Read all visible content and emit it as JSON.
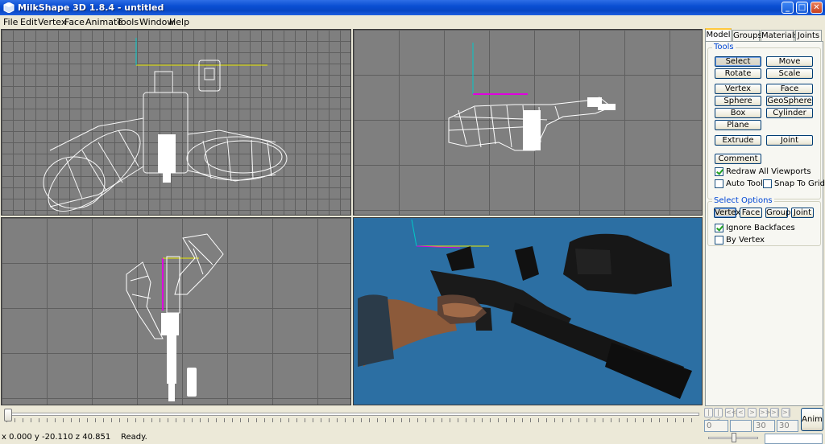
{
  "window": {
    "title": "MilkShape 3D 1.8.4 - untitled",
    "minimize": "_",
    "maximize": "□",
    "close": "✕"
  },
  "menu": [
    "File",
    "Edit",
    "Vertex",
    "Face",
    "Animate",
    "Tools",
    "Window",
    "Help"
  ],
  "tabs": [
    "Model",
    "Groups",
    "Materials",
    "Joints"
  ],
  "tools": {
    "title": "Tools",
    "buttons": [
      "Select",
      "Move",
      "Rotate",
      "Scale",
      "Vertex",
      "Face",
      "Sphere",
      "GeoSphere",
      "Box",
      "Cylinder",
      "Plane",
      "Extrude",
      "Joint",
      "Comment"
    ],
    "checks": [
      {
        "label": "Redraw All Viewports",
        "checked": true
      },
      {
        "label": "Auto Tool",
        "checked": false
      },
      {
        "label": "Snap To Grid",
        "checked": false
      }
    ]
  },
  "select_options": {
    "title": "Select Options",
    "buttons": [
      "Vertex",
      "Face",
      "Group",
      "Joint"
    ],
    "checks": [
      {
        "label": "Ignore Backfaces",
        "checked": true
      },
      {
        "label": "By Vertex",
        "checked": false
      }
    ]
  },
  "anim": {
    "nav": [
      "|<",
      "|<",
      "<<",
      "<",
      ">",
      ">>",
      ">|",
      ">|"
    ],
    "fields": [
      "0",
      "",
      "30",
      "30"
    ],
    "button": "Anim"
  },
  "status": {
    "coords": "x 0.000 y -20.110 z 40.851",
    "message": "Ready."
  },
  "colors": {
    "viewport_bg": "#7f7f7f",
    "perspective_bg": "#2c6fa3",
    "wire": "#ffffff",
    "titlebar": "#0a4ed2"
  }
}
